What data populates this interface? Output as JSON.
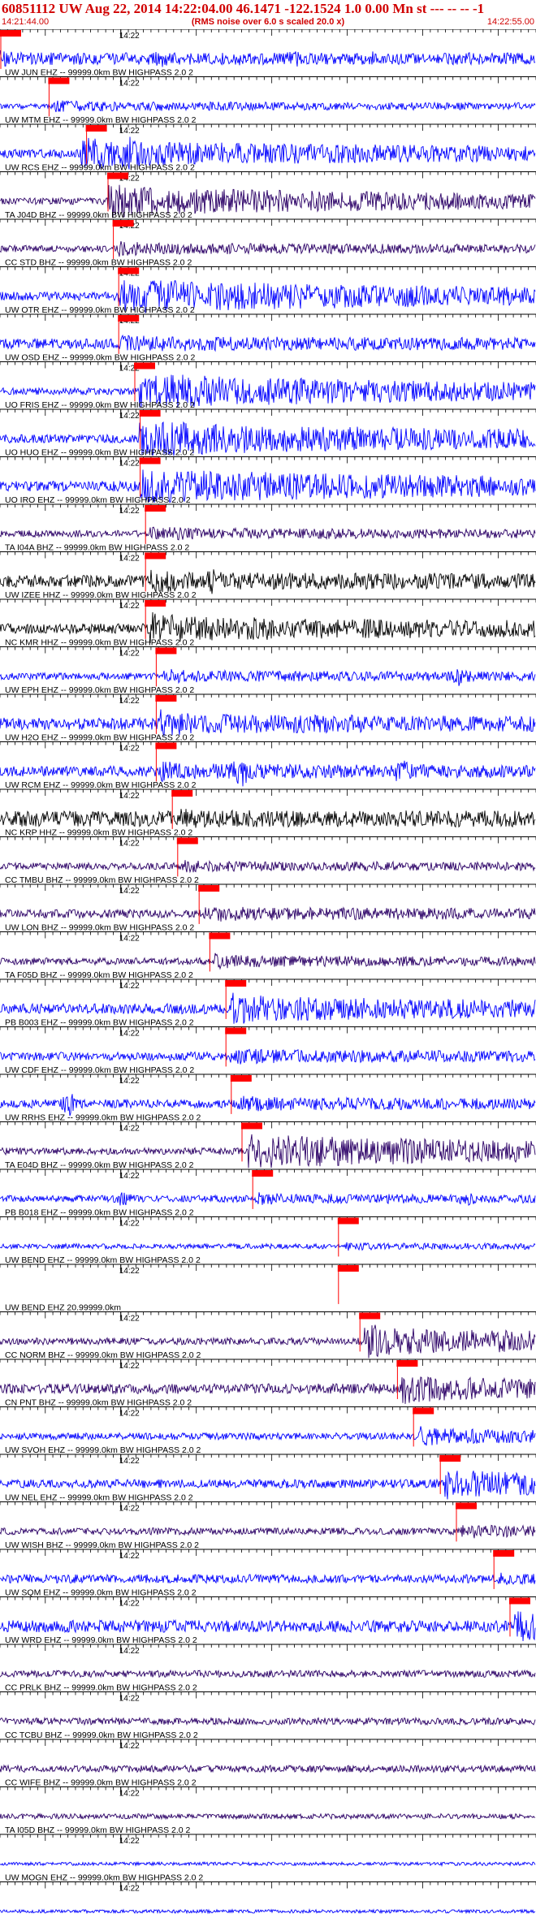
{
  "header": {
    "title": "60851112 UW Aug 22, 2014 14:22:04.00   46.1471 -122.1524  1.0 0.00 Mn st --- -- --  -1",
    "subtitle": "(RMS noise over 6.0 s scaled 20.0 x)",
    "start_time": "14:21:44.00",
    "end_time": "14:22:55.00"
  },
  "colors": {
    "header_text": "#d00000",
    "trace_blue": "#0000ff",
    "trace_purple": "#2b0066",
    "trace_black": "#000000",
    "pick": "#ff0000"
  },
  "chart_data": {
    "type": "line",
    "title": "60851112 UW Aug 22, 2014 14:22:04.00   46.1471 -122.1524  1.0 0.00 Mn st --- -- --  -1",
    "xlabel": "14:22",
    "time_range": [
      "14:21:44.00",
      "14:22:55.00"
    ],
    "series": [
      {
        "label": "UW JUN EHZ -- 99999.0km BW  HIGHPASS  2.0  2",
        "color": "blue",
        "amp": 0.35,
        "pick": 0.0,
        "onset": 0.0,
        "post": 0.35,
        "bursts": [
          [
            0.3,
            0.5
          ],
          [
            0.45,
            0.4
          ],
          [
            0.55,
            0.5
          ],
          [
            0.7,
            0.45
          ]
        ]
      },
      {
        "label": "UW MTM EHZ -- 99999.0km BW  HIGHPASS  2.0  2",
        "color": "blue",
        "amp": 0.15,
        "pick": 0.09,
        "onset": 0.1,
        "post": 0.3,
        "bursts": []
      },
      {
        "label": "UW RCS EHZ -- 99999.0km BW  HIGHPASS  2.0  2",
        "color": "blue",
        "amp": 0.25,
        "pick": 0.16,
        "onset": 0.15,
        "post": 0.8,
        "bursts": [
          [
            0.24,
            1.0
          ]
        ]
      },
      {
        "label": "TA J04D BHZ -- 99999.0km BW  HIGHPASS  2.0  2",
        "color": "purple",
        "amp": 0.2,
        "pick": 0.2,
        "onset": 0.2,
        "post": 0.85,
        "bursts": []
      },
      {
        "label": "CC STD BHZ -- 99999.0km BW  HIGHPASS  2.0  2",
        "color": "purple",
        "amp": 0.2,
        "pick": 0.21,
        "onset": 0.22,
        "post": 0.35,
        "bursts": []
      },
      {
        "label": "UW OTR EHZ -- 99999.0km BW  HIGHPASS  2.0  2",
        "color": "blue",
        "amp": 0.25,
        "pick": 0.22,
        "onset": 0.22,
        "post": 1.0,
        "bursts": []
      },
      {
        "label": "UW OSD EHZ -- 99999.0km BW  HIGHPASS  2.0  2",
        "color": "blue",
        "amp": 0.3,
        "pick": 0.22,
        "onset": 0.22,
        "post": 0.45,
        "bursts": []
      },
      {
        "label": "UO FRIS EHZ -- 99999.0km BW  HIGHPASS  2.0  2",
        "color": "blue",
        "amp": 0.2,
        "pick": 0.25,
        "onset": 0.26,
        "post": 1.0,
        "bursts": [
          [
            0.64,
            0.6
          ]
        ]
      },
      {
        "label": "UO HUO EHZ -- 99999.0km BW  HIGHPASS  2.0  2",
        "color": "blue",
        "amp": 0.25,
        "pick": 0.26,
        "onset": 0.26,
        "post": 1.0,
        "bursts": []
      },
      {
        "label": "UO IRO EHZ -- 99999.0km BW  HIGHPASS  2.0  2",
        "color": "blue",
        "amp": 0.3,
        "pick": 0.26,
        "onset": 0.26,
        "post": 1.0,
        "bursts": [
          [
            0.64,
            0.7
          ]
        ]
      },
      {
        "label": "TA I04A BHZ -- 99999.0km BW  HIGHPASS  2.0  2",
        "color": "purple",
        "amp": 0.2,
        "pick": 0.27,
        "onset": 0.28,
        "post": 0.35,
        "bursts": []
      },
      {
        "label": "UW IZEE HHZ -- 99999.0km BW  HIGHPASS  2.0  2",
        "color": "black",
        "amp": 0.35,
        "pick": 0.27,
        "onset": 0.28,
        "post": 0.55,
        "bursts": [
          [
            0.4,
            0.9
          ],
          [
            0.8,
            0.7
          ]
        ]
      },
      {
        "label": "NC KMR HHZ -- 99999.0km BW  HIGHPASS  2.0  2",
        "color": "black",
        "amp": 0.3,
        "pick": 0.27,
        "onset": 0.28,
        "post": 0.75,
        "bursts": []
      },
      {
        "label": "UW EPH EHZ -- 99999.0km BW  HIGHPASS  2.0  2",
        "color": "blue",
        "amp": 0.2,
        "pick": 0.29,
        "onset": 0.3,
        "post": 0.35,
        "bursts": [
          [
            0.86,
            0.6
          ]
        ]
      },
      {
        "label": "UW H2O EHZ -- 99999.0km BW  HIGHPASS  2.0  2",
        "color": "blue",
        "amp": 0.35,
        "pick": 0.29,
        "onset": 0.3,
        "post": 0.6,
        "bursts": []
      },
      {
        "label": "UW RCM EHZ -- 99999.0km BW  HIGHPASS  2.0  2",
        "color": "blue",
        "amp": 0.3,
        "pick": 0.29,
        "onset": 0.3,
        "post": 0.45,
        "bursts": [
          [
            0.45,
            0.95
          ],
          [
            0.75,
            0.8
          ]
        ]
      },
      {
        "label": "NC KRP HHZ -- 99999.0km BW  HIGHPASS  2.0  2",
        "color": "black",
        "amp": 0.45,
        "pick": 0.32,
        "onset": 0.33,
        "post": 0.5,
        "bursts": []
      },
      {
        "label": "CC TMBU BHZ -- 99999.0km BW  HIGHPASS  2.0  2",
        "color": "purple",
        "amp": 0.2,
        "pick": 0.33,
        "onset": 0.34,
        "post": 0.3,
        "bursts": []
      },
      {
        "label": "UW LON BHZ -- 99999.0km BW  HIGHPASS  2.0  2",
        "color": "purple",
        "amp": 0.25,
        "pick": 0.37,
        "onset": 0.38,
        "post": 0.4,
        "bursts": []
      },
      {
        "label": "TA F05D BHZ -- 99999.0km BW  HIGHPASS  2.0  2",
        "color": "purple",
        "amp": 0.2,
        "pick": 0.39,
        "onset": 0.4,
        "post": 0.35,
        "bursts": []
      },
      {
        "label": "PB B003 EHZ -- 99999.0km BW  HIGHPASS  2.0  2",
        "color": "blue",
        "amp": 0.3,
        "pick": 0.42,
        "onset": 0.43,
        "post": 0.75,
        "bursts": []
      },
      {
        "label": "UW CDF EHZ -- 99999.0km BW  HIGHPASS  2.0  2",
        "color": "blue",
        "amp": 0.25,
        "pick": 0.42,
        "onset": 0.43,
        "post": 0.4,
        "bursts": []
      },
      {
        "label": "UW RRHS EHZ -- 99999.0km BW  HIGHPASS  2.0  2",
        "color": "blue",
        "amp": 0.25,
        "pick": 0.43,
        "onset": 0.44,
        "post": 0.4,
        "bursts": [
          [
            0.13,
            0.8
          ]
        ]
      },
      {
        "label": "TA E04D BHZ -- 99999.0km BW  HIGHPASS  2.0  2",
        "color": "purple",
        "amp": 0.2,
        "pick": 0.45,
        "onset": 0.46,
        "post": 1.0,
        "bursts": []
      },
      {
        "label": "PB B018 EHZ -- 99999.0km BW  HIGHPASS  2.0  2",
        "color": "blue",
        "amp": 0.2,
        "pick": 0.47,
        "onset": 0.48,
        "post": 0.3,
        "bursts": [
          [
            0.23,
            0.45
          ],
          [
            0.87,
            0.5
          ]
        ]
      },
      {
        "label": "UW BEND EHZ -- 99999.0km BW  HIGHPASS  2.0  2",
        "color": "blue",
        "amp": 0.15,
        "pick": 0.63,
        "onset": 0.64,
        "post": 0.2,
        "bursts": []
      },
      {
        "label": "UW BEND EHZ 20.99999.0km",
        "color": "blue",
        "amp": 0.0,
        "pick": 0.63,
        "onset": 0.64,
        "post": 0.0,
        "bursts": []
      },
      {
        "label": "CC NORM BHZ -- 99999.0km BW  HIGHPASS  2.0  2",
        "color": "purple",
        "amp": 0.2,
        "pick": 0.67,
        "onset": 0.68,
        "post": 0.8,
        "bursts": []
      },
      {
        "label": "CN PNT BHZ -- 99999.0km BW  HIGHPASS  2.0  2",
        "color": "purple",
        "amp": 0.3,
        "pick": 0.74,
        "onset": 0.75,
        "post": 0.7,
        "bursts": []
      },
      {
        "label": "UW SVOH EHZ -- 99999.0km BW  HIGHPASS  2.0  2",
        "color": "blue",
        "amp": 0.2,
        "pick": 0.77,
        "onset": 0.78,
        "post": 0.45,
        "bursts": []
      },
      {
        "label": "UW NEL EHZ -- 99999.0km BW  HIGHPASS  2.0  2",
        "color": "blue",
        "amp": 0.25,
        "pick": 0.82,
        "onset": 0.83,
        "post": 0.75,
        "bursts": []
      },
      {
        "label": "UW WISH BHZ -- 99999.0km BW  HIGHPASS  2.0  2",
        "color": "purple",
        "amp": 0.2,
        "pick": 0.85,
        "onset": 0.86,
        "post": 0.35,
        "bursts": []
      },
      {
        "label": "UW SQM EHZ -- 99999.0km BW  HIGHPASS  2.0  2",
        "color": "blue",
        "amp": 0.25,
        "pick": 0.92,
        "onset": 0.93,
        "post": 0.3,
        "bursts": []
      },
      {
        "label": "UW WRD EHZ -- 99999.0km BW  HIGHPASS  2.0  2",
        "color": "blue",
        "amp": 0.35,
        "pick": 0.95,
        "onset": 0.96,
        "post": 0.7,
        "bursts": []
      },
      {
        "label": "CC PRLK BHZ -- 99999.0km BW  HIGHPASS  2.0  2",
        "color": "purple",
        "amp": 0.2,
        "pick": null,
        "onset": null,
        "post": 0.2,
        "bursts": []
      },
      {
        "label": "CC TCBU BHZ -- 99999.0km BW  HIGHPASS  2.0  2",
        "color": "purple",
        "amp": 0.2,
        "pick": null,
        "onset": null,
        "post": 0.2,
        "bursts": []
      },
      {
        "label": "CC WIFE BHZ -- 99999.0km BW  HIGHPASS  2.0  2",
        "color": "purple",
        "amp": 0.2,
        "pick": null,
        "onset": null,
        "post": 0.2,
        "bursts": []
      },
      {
        "label": "TA I05D BHZ -- 99999.0km BW  HIGHPASS  2.0  2",
        "color": "purple",
        "amp": 0.15,
        "pick": null,
        "onset": null,
        "post": 0.15,
        "bursts": []
      },
      {
        "label": "UW MOGN EHZ -- 99999.0km BW  HIGHPASS  2.0  2",
        "color": "blue",
        "amp": 0.1,
        "pick": null,
        "onset": null,
        "post": 0.1,
        "bursts": []
      },
      {
        "label": "",
        "color": "blue",
        "amp": 0.1,
        "pick": null,
        "onset": null,
        "post": 0.1,
        "bursts": []
      }
    ]
  }
}
